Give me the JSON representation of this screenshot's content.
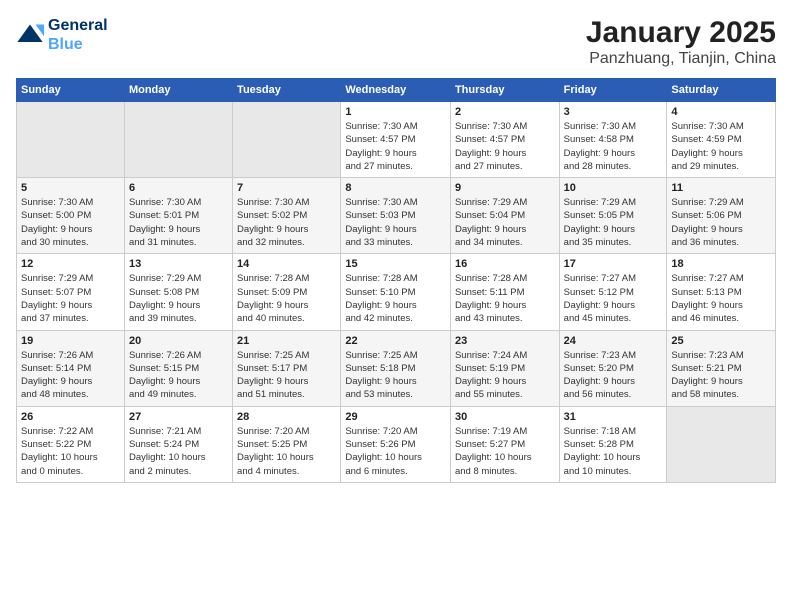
{
  "logo": {
    "line1": "General",
    "line2": "Blue"
  },
  "title": "January 2025",
  "subtitle": "Panzhuang, Tianjin, China",
  "headers": [
    "Sunday",
    "Monday",
    "Tuesday",
    "Wednesday",
    "Thursday",
    "Friday",
    "Saturday"
  ],
  "weeks": [
    [
      {
        "day": "",
        "info": ""
      },
      {
        "day": "",
        "info": ""
      },
      {
        "day": "",
        "info": ""
      },
      {
        "day": "1",
        "info": "Sunrise: 7:30 AM\nSunset: 4:57 PM\nDaylight: 9 hours\nand 27 minutes."
      },
      {
        "day": "2",
        "info": "Sunrise: 7:30 AM\nSunset: 4:57 PM\nDaylight: 9 hours\nand 27 minutes."
      },
      {
        "day": "3",
        "info": "Sunrise: 7:30 AM\nSunset: 4:58 PM\nDaylight: 9 hours\nand 28 minutes."
      },
      {
        "day": "4",
        "info": "Sunrise: 7:30 AM\nSunset: 4:59 PM\nDaylight: 9 hours\nand 29 minutes."
      }
    ],
    [
      {
        "day": "5",
        "info": "Sunrise: 7:30 AM\nSunset: 5:00 PM\nDaylight: 9 hours\nand 30 minutes."
      },
      {
        "day": "6",
        "info": "Sunrise: 7:30 AM\nSunset: 5:01 PM\nDaylight: 9 hours\nand 31 minutes."
      },
      {
        "day": "7",
        "info": "Sunrise: 7:30 AM\nSunset: 5:02 PM\nDaylight: 9 hours\nand 32 minutes."
      },
      {
        "day": "8",
        "info": "Sunrise: 7:30 AM\nSunset: 5:03 PM\nDaylight: 9 hours\nand 33 minutes."
      },
      {
        "day": "9",
        "info": "Sunrise: 7:29 AM\nSunset: 5:04 PM\nDaylight: 9 hours\nand 34 minutes."
      },
      {
        "day": "10",
        "info": "Sunrise: 7:29 AM\nSunset: 5:05 PM\nDaylight: 9 hours\nand 35 minutes."
      },
      {
        "day": "11",
        "info": "Sunrise: 7:29 AM\nSunset: 5:06 PM\nDaylight: 9 hours\nand 36 minutes."
      }
    ],
    [
      {
        "day": "12",
        "info": "Sunrise: 7:29 AM\nSunset: 5:07 PM\nDaylight: 9 hours\nand 37 minutes."
      },
      {
        "day": "13",
        "info": "Sunrise: 7:29 AM\nSunset: 5:08 PM\nDaylight: 9 hours\nand 39 minutes."
      },
      {
        "day": "14",
        "info": "Sunrise: 7:28 AM\nSunset: 5:09 PM\nDaylight: 9 hours\nand 40 minutes."
      },
      {
        "day": "15",
        "info": "Sunrise: 7:28 AM\nSunset: 5:10 PM\nDaylight: 9 hours\nand 42 minutes."
      },
      {
        "day": "16",
        "info": "Sunrise: 7:28 AM\nSunset: 5:11 PM\nDaylight: 9 hours\nand 43 minutes."
      },
      {
        "day": "17",
        "info": "Sunrise: 7:27 AM\nSunset: 5:12 PM\nDaylight: 9 hours\nand 45 minutes."
      },
      {
        "day": "18",
        "info": "Sunrise: 7:27 AM\nSunset: 5:13 PM\nDaylight: 9 hours\nand 46 minutes."
      }
    ],
    [
      {
        "day": "19",
        "info": "Sunrise: 7:26 AM\nSunset: 5:14 PM\nDaylight: 9 hours\nand 48 minutes."
      },
      {
        "day": "20",
        "info": "Sunrise: 7:26 AM\nSunset: 5:15 PM\nDaylight: 9 hours\nand 49 minutes."
      },
      {
        "day": "21",
        "info": "Sunrise: 7:25 AM\nSunset: 5:17 PM\nDaylight: 9 hours\nand 51 minutes."
      },
      {
        "day": "22",
        "info": "Sunrise: 7:25 AM\nSunset: 5:18 PM\nDaylight: 9 hours\nand 53 minutes."
      },
      {
        "day": "23",
        "info": "Sunrise: 7:24 AM\nSunset: 5:19 PM\nDaylight: 9 hours\nand 55 minutes."
      },
      {
        "day": "24",
        "info": "Sunrise: 7:23 AM\nSunset: 5:20 PM\nDaylight: 9 hours\nand 56 minutes."
      },
      {
        "day": "25",
        "info": "Sunrise: 7:23 AM\nSunset: 5:21 PM\nDaylight: 9 hours\nand 58 minutes."
      }
    ],
    [
      {
        "day": "26",
        "info": "Sunrise: 7:22 AM\nSunset: 5:22 PM\nDaylight: 10 hours\nand 0 minutes."
      },
      {
        "day": "27",
        "info": "Sunrise: 7:21 AM\nSunset: 5:24 PM\nDaylight: 10 hours\nand 2 minutes."
      },
      {
        "day": "28",
        "info": "Sunrise: 7:20 AM\nSunset: 5:25 PM\nDaylight: 10 hours\nand 4 minutes."
      },
      {
        "day": "29",
        "info": "Sunrise: 7:20 AM\nSunset: 5:26 PM\nDaylight: 10 hours\nand 6 minutes."
      },
      {
        "day": "30",
        "info": "Sunrise: 7:19 AM\nSunset: 5:27 PM\nDaylight: 10 hours\nand 8 minutes."
      },
      {
        "day": "31",
        "info": "Sunrise: 7:18 AM\nSunset: 5:28 PM\nDaylight: 10 hours\nand 10 minutes."
      },
      {
        "day": "",
        "info": ""
      }
    ]
  ],
  "colors": {
    "header_bg": "#2b5db5",
    "odd_row_bg": "#f5f5f5",
    "even_row_bg": "#ffffff",
    "empty_bg": "#e8e8e8"
  }
}
